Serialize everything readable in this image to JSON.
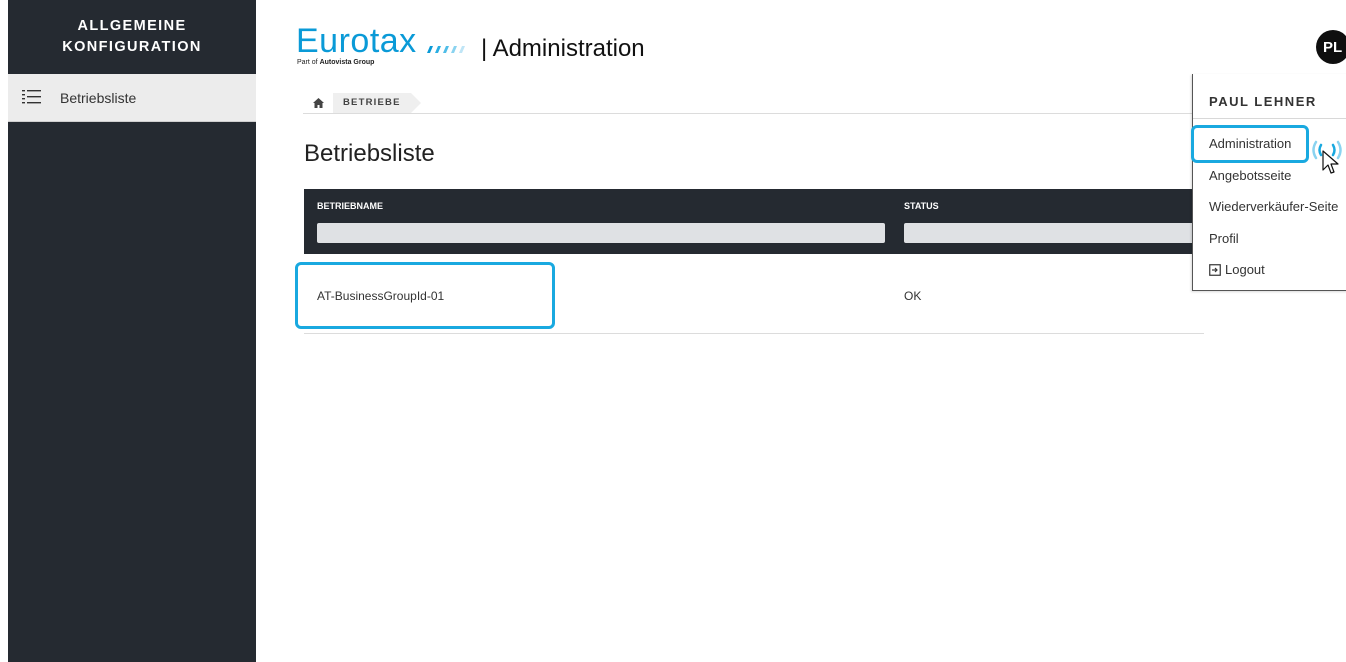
{
  "sidebar": {
    "title_line1": "ALLGEMEINE",
    "title_line2": "KONFIGURATION",
    "items": [
      {
        "label": "Betriebsliste",
        "icon": "list-icon"
      }
    ]
  },
  "header": {
    "logo_word": "Eurotax",
    "logo_sub_prefix": "Part of",
    "logo_sub_brand": "Autovista Group",
    "app_title": "| Administration",
    "avatar_initials": "PL"
  },
  "breadcrumb": {
    "home_icon": "home-icon",
    "items": [
      "BETRIEBE"
    ]
  },
  "page": {
    "title": "Betriebsliste"
  },
  "table": {
    "columns": [
      "BETRIEBNAME",
      "STATUS"
    ],
    "rows": [
      {
        "name": "AT-BusinessGroupId-01",
        "status": "OK"
      }
    ]
  },
  "user_menu": {
    "user_name": "PAUL LEHNER",
    "items": [
      "Administration",
      "Angebotsseite",
      "Wiederverkäufer-Seite",
      "Profil",
      "Logout"
    ]
  },
  "colors": {
    "sidebar_bg": "#252a31",
    "brand_blue": "#0a9ad7",
    "highlight": "#19a9e0"
  }
}
